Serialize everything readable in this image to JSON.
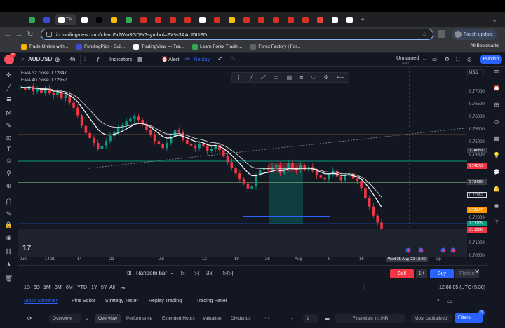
{
  "browser": {
    "tabs": [
      {
        "fav_color": "#34a853"
      },
      {
        "fav_color": "#3c4bd6"
      },
      {
        "label": "TW",
        "fav_color": "#ffffff"
      },
      {
        "fav_color": "#ffffff"
      },
      {
        "fav_color": "#000000"
      },
      {
        "fav_color": "#fbbc04"
      },
      {
        "fav_color": "#34a853"
      },
      {
        "fav_color": "#d93025"
      },
      {
        "fav_color": "#d93025"
      },
      {
        "fav_color": "#d93025"
      },
      {
        "fav_color": "#d93025"
      },
      {
        "fav_color": "#ffffff"
      },
      {
        "fav_color": "#d93025"
      },
      {
        "fav_color": "#fbbc04"
      },
      {
        "fav_color": "#d93025"
      },
      {
        "fav_color": "#d93025"
      },
      {
        "fav_color": "#d93025"
      },
      {
        "fav_color": "#d93025"
      },
      {
        "fav_color": "#d93025"
      },
      {
        "fav_color": "#ea4335"
      },
      {
        "fav_color": "#ffffff"
      },
      {
        "fav_color": "#ffffff"
      }
    ],
    "new_tab": "+",
    "url": "in.tradingview.com/chart/5dWm3GD9/?symbol=FX%3AAUDUSD",
    "finish_update": "Finish update",
    "bookmarks": [
      {
        "label": "Trade Online with...",
        "color": "#f5b400"
      },
      {
        "label": "FundingPips - Buil...",
        "color": "#3c4bd6"
      },
      {
        "label": "TradingView — Tra...",
        "color": "#ffffff"
      },
      {
        "label": "Learn Forex Tradin...",
        "color": "#34a853"
      },
      {
        "label": "Forex Factory | For...",
        "color": "#5f6368"
      }
    ],
    "all_bookmarks": "All Bookmarks"
  },
  "header": {
    "badge": "11",
    "symbol": "AUDUSD",
    "interval": "4h",
    "indicators": "Indicators",
    "alert": "Alert",
    "replay": "Replay",
    "layout_name": "Unnamed",
    "save_label": "Save",
    "publish": "Publish"
  },
  "legend": {
    "ema1": "EMA 32 close",
    "ema1_value": "0.72847",
    "ema2": "EMA 40 close",
    "ema2_value": "0.72952"
  },
  "chart_data": {
    "type": "candlestick",
    "symbol": "AUDUSD",
    "currency": "USD",
    "interval": "4h",
    "ylim": [
      0.705,
      0.777
    ],
    "y_ticks": [
      "0.77000",
      "0.76500",
      "0.76000",
      "0.75500",
      "0.75000",
      "0.74500",
      "0.72000",
      "0.71000",
      "0.70500"
    ],
    "x_ticks": [
      "Jun",
      "14:30",
      "14",
      "21",
      "Jul",
      "12",
      "19",
      "26",
      "Aug",
      "9",
      "16",
      "ep"
    ],
    "price_tags": [
      {
        "value": "0.74689",
        "color": "#363a45"
      },
      {
        "value": "0.74073",
        "color": "#f23645"
      },
      {
        "value": "0.73439",
        "color": "#363a45"
      },
      {
        "value": "0.72952",
        "color": "#131722"
      },
      {
        "value": "0.72347",
        "color": "#ff9800"
      },
      {
        "value": "0.71795",
        "color": "#089981"
      },
      {
        "value": "0.71566",
        "color": "#f23645"
      }
    ],
    "crosshair_time": "Wed 25 Aug '21   18:30",
    "horizontal_lines": [
      {
        "price": 0.7533,
        "color": "#c0703a"
      },
      {
        "price": 0.7428,
        "color": "#089981"
      },
      {
        "price": 0.7344,
        "color": "#6a9a6a"
      },
      {
        "price": 0.721,
        "color": "#2962ff"
      },
      {
        "price": 0.718,
        "color": "#2962ff"
      }
    ],
    "position": {
      "entry": 0.7385,
      "stop": 0.742,
      "target": 0.718
    },
    "close_series": [
      0.7722,
      0.7712,
      0.7727,
      0.7705,
      0.7715,
      0.77,
      0.7716,
      0.77,
      0.769,
      0.7704,
      0.7678,
      0.769,
      0.766,
      0.764,
      0.761,
      0.7568,
      0.754,
      0.752,
      0.75,
      0.7478,
      0.749,
      0.7508,
      0.7528,
      0.7545,
      0.756,
      0.7572,
      0.7586,
      0.7596,
      0.7605,
      0.7592,
      0.7574,
      0.7552,
      0.7532,
      0.7508,
      0.7495,
      0.748,
      0.75,
      0.7525,
      0.755,
      0.7544,
      0.7512,
      0.7498,
      0.749,
      0.748,
      0.7497,
      0.7488,
      0.7468,
      0.7478,
      0.7492,
      0.7472,
      0.745,
      0.7424,
      0.74,
      0.738,
      0.7358,
      0.734,
      0.732,
      0.733,
      0.7372,
      0.7392,
      0.74,
      0.7394,
      0.7404,
      0.7412,
      0.738,
      0.7398,
      0.742,
      0.7398,
      0.7392,
      0.7412,
      0.7395,
      0.7405,
      0.739,
      0.7372,
      0.7362,
      0.7355,
      0.7375,
      0.739,
      0.7368,
      0.7352,
      0.7374,
      0.738,
      0.736,
      0.735,
      0.7322,
      0.7282,
      0.7248,
      0.7212,
      0.7185,
      0.7157
    ]
  },
  "replay_bar": {
    "random_bar": "Random bar",
    "speed": "3x",
    "sell": "Sell",
    "qty": "1K",
    "buy": "Buy",
    "flatten": "Flatten"
  },
  "ranges": [
    "1D",
    "5D",
    "1M",
    "3M",
    "6M",
    "YTD",
    "1Y",
    "5Y",
    "All"
  ],
  "clock": "12:06:05 (UTC+5:30)",
  "bottom_tabs": [
    "Stock Screener",
    "Pine Editor",
    "Strategy Tester",
    "Replay Trading",
    "Trading Panel"
  ],
  "screener": {
    "overview_select": "Overview",
    "tabs": [
      "Overview",
      "Performance",
      "Extended Hours",
      "Valuation",
      "Dividends"
    ],
    "count": "1",
    "financials": "Financials in: INR",
    "sort": "Most capitalized",
    "filters": "Filters",
    "filters_badge": "3"
  }
}
